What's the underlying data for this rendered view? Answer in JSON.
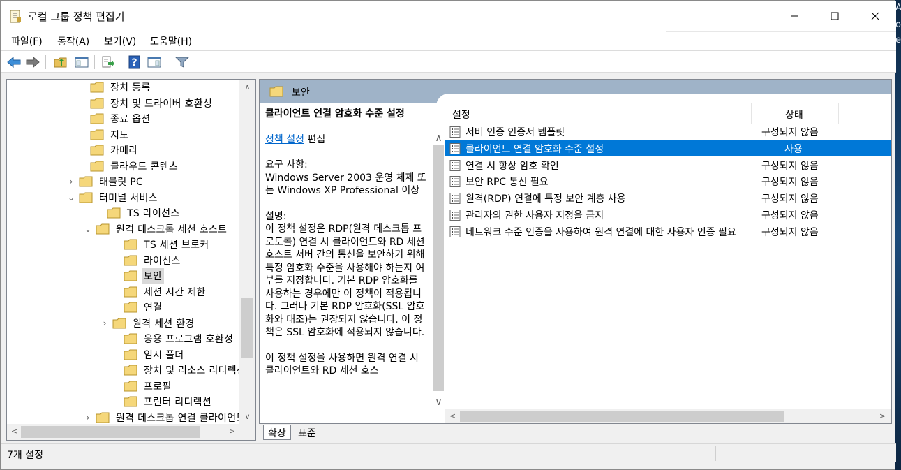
{
  "window": {
    "title": "로컬 그룹 정책 편집기"
  },
  "desktop": {
    "fragments": [
      "Ar",
      "o",
      "e"
    ]
  },
  "menu": [
    "파일(F)",
    "동작(A)",
    "보기(V)",
    "도움말(H)"
  ],
  "toolbar": [
    "back-icon",
    "forward-icon",
    "up-folder-icon",
    "show-hide-tree-icon",
    "export-list-icon",
    "help-icon",
    "properties-view-icon",
    "filter-icon"
  ],
  "tree": {
    "items": [
      {
        "label": "장치 등록",
        "expander": ""
      },
      {
        "label": "장치 및 드라이버 호환성",
        "expander": ""
      },
      {
        "label": "종료 옵션",
        "expander": ""
      },
      {
        "label": "지도",
        "expander": ""
      },
      {
        "label": "카메라",
        "expander": ""
      },
      {
        "label": "클라우드 콘텐츠",
        "expander": ""
      },
      {
        "label": "태블릿 PC",
        "expander": "›"
      },
      {
        "label": "터미널 서비스",
        "expander": "⌄"
      },
      {
        "label": "TS 라이선스",
        "expander": ""
      },
      {
        "label": "원격 데스크톱 세션 호스트",
        "expander": "⌄"
      },
      {
        "label": "TS 세션 브로커",
        "expander": ""
      },
      {
        "label": "라이선스",
        "expander": ""
      },
      {
        "label": "보안",
        "expander": "",
        "selected": true
      },
      {
        "label": "세션 시간 제한",
        "expander": ""
      },
      {
        "label": "연결",
        "expander": ""
      },
      {
        "label": "원격 세션 환경",
        "expander": "›"
      },
      {
        "label": "응용 프로그램 호환성",
        "expander": ""
      },
      {
        "label": "임시 폴더",
        "expander": ""
      },
      {
        "label": "장치 및 리소스 리디렉션",
        "expander": ""
      },
      {
        "label": "프로필",
        "expander": ""
      },
      {
        "label": "프린터 리디렉션",
        "expander": ""
      },
      {
        "label": "원격 데스크톱 연결 클라이언트",
        "expander": "›"
      }
    ]
  },
  "pane": {
    "header": "보안",
    "desc": {
      "title": "클라이언트 연결 암호화 수준 설정",
      "link": "정책 설정",
      "edit": " 편집",
      "req_label": "요구 사항:",
      "req_text": "Windows Server 2003 운영 체제 또는 Windows XP Professional 이상",
      "desc_label": "설명:",
      "desc_text": "이 정책 설정은 RDP(원격 데스크톱 프로토콜) 연결 시 클라이언트와 RD 세션 호스트 서버 간의 통신을 보안하기 위해 특정 암호화 수준을 사용해야 하는지 여부를 지정합니다. 기본 RDP 암호화를 사용하는 경우에만 이 정책이 적용됩니다. 그러나 기본 RDP 암호화(SSL 암호화와 대조)는 권장되지 않습니다. 이 정책은 SSL 암호화에 적용되지 않습니다.",
      "more_text": "이 정책 설정을 사용하면 원격 연결 시 클라이언트와 RD 세션 호스"
    },
    "columns": {
      "setting": "설정",
      "state": "상태"
    },
    "rows": [
      {
        "name": "서버 인증 인증서 템플릿",
        "state": "구성되지 않음"
      },
      {
        "name": "클라이언트 연결 암호화 수준 설정",
        "state": "사용",
        "selected": true
      },
      {
        "name": "연결 시 항상 암호 확인",
        "state": "구성되지 않음"
      },
      {
        "name": "보안 RPC 통신 필요",
        "state": "구성되지 않음"
      },
      {
        "name": "원격(RDP) 연결에 특정 보안 계층 사용",
        "state": "구성되지 않음"
      },
      {
        "name": "관리자의 권한 사용자 지정을 금지",
        "state": "구성되지 않음"
      },
      {
        "name": "네트워크 수준 인증을 사용하여 원격 연결에 대한 사용자 인증 필요",
        "state": "구성되지 않음"
      }
    ]
  },
  "tabs": [
    "확장",
    "표준"
  ],
  "status": {
    "text": "7개 설정"
  },
  "colors": {
    "selection": "#0078d7",
    "header": "#9fb3c8",
    "link": "#0066cc"
  }
}
